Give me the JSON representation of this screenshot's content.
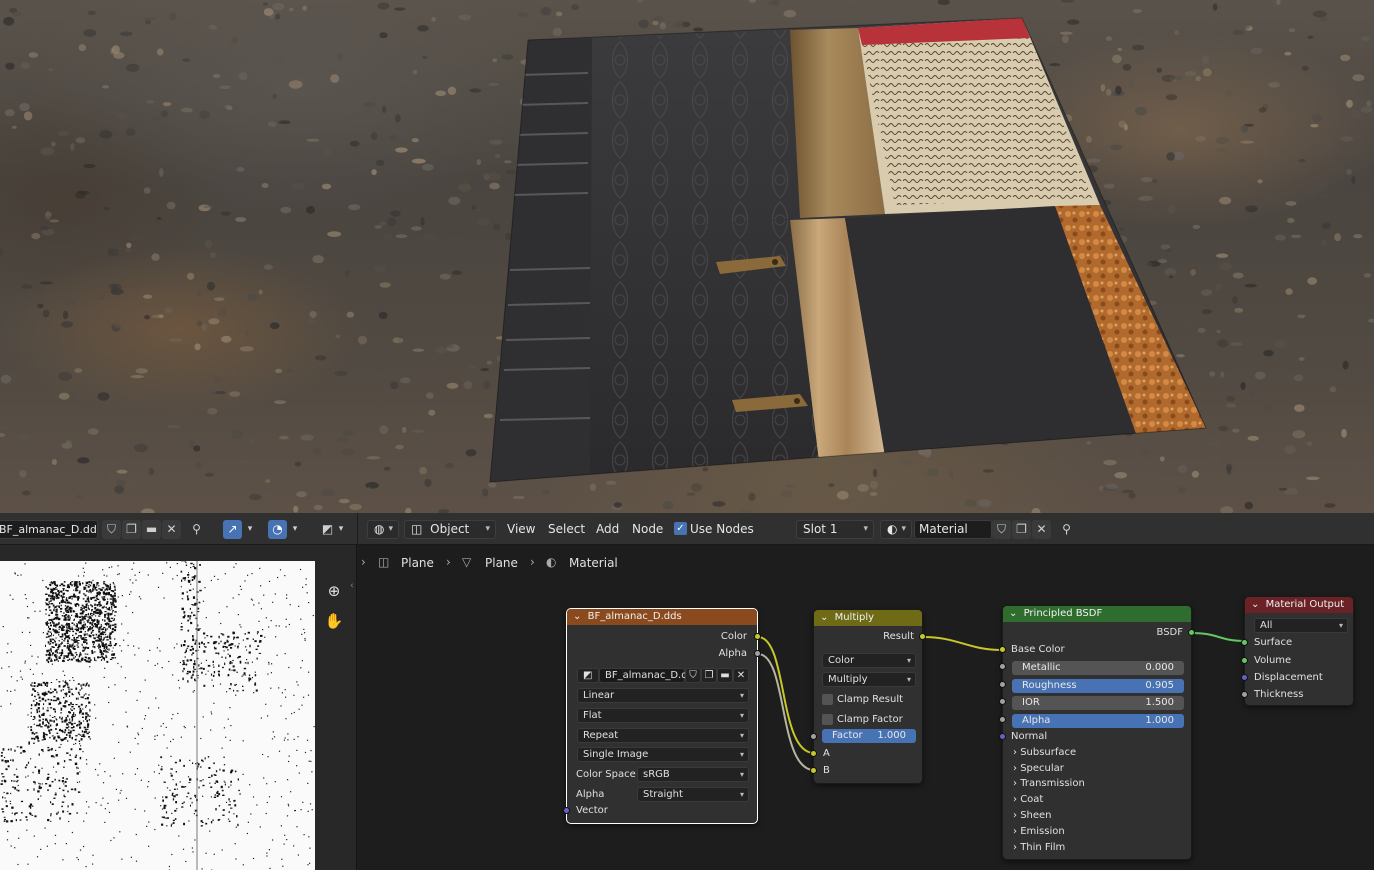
{
  "image_editor": {
    "image_name": "BF_almanac_D.dds"
  },
  "node_editor": {
    "header": {
      "object_mode": "Object",
      "menus": [
        "View",
        "Select",
        "Add",
        "Node"
      ],
      "use_nodes_label": "Use Nodes",
      "slot": "Slot 1",
      "material_name": "Material"
    },
    "breadcrumb": [
      "Plane",
      "Plane",
      "Material"
    ],
    "image_node": {
      "title": "BF_almanac_D.dds",
      "outputs": [
        "Color",
        "Alpha"
      ],
      "image_name": "BF_almanac_D.dds",
      "interpolation": "Linear",
      "projection": "Flat",
      "extension": "Repeat",
      "source": "Single Image",
      "color_space_label": "Color Space",
      "color_space": "sRGB",
      "alpha_label": "Alpha",
      "alpha_mode": "Straight",
      "vector_label": "Vector"
    },
    "multiply_node": {
      "title": "Multiply",
      "output": "Result",
      "data_type": "Color",
      "blend_mode": "Multiply",
      "clamp_result": "Clamp Result",
      "clamp_factor": "Clamp Factor",
      "factor_label": "Factor",
      "factor_value": "1.000",
      "input_a": "A",
      "input_b": "B"
    },
    "bsdf_node": {
      "title": "Principled BSDF",
      "output": "BSDF",
      "base_color": "Base Color",
      "metallic_label": "Metallic",
      "metallic_value": "0.000",
      "roughness_label": "Roughness",
      "roughness_value": "0.905",
      "ior_label": "IOR",
      "ior_value": "1.500",
      "alpha_label": "Alpha",
      "alpha_value": "1.000",
      "normal": "Normal",
      "panels": [
        "Subsurface",
        "Specular",
        "Transmission",
        "Coat",
        "Sheen",
        "Emission",
        "Thin Film"
      ]
    },
    "output_node": {
      "title": "Material Output",
      "target": "All",
      "inputs": [
        "Surface",
        "Volume",
        "Displacement",
        "Thickness"
      ]
    }
  },
  "colors": {
    "image_node_header": "#8a4a1e",
    "multiply_node_header": "#6e6a16",
    "bsdf_node_header": "#2f6d2f",
    "output_node_header": "#6b2226",
    "accent_blue": "#4772b3"
  }
}
